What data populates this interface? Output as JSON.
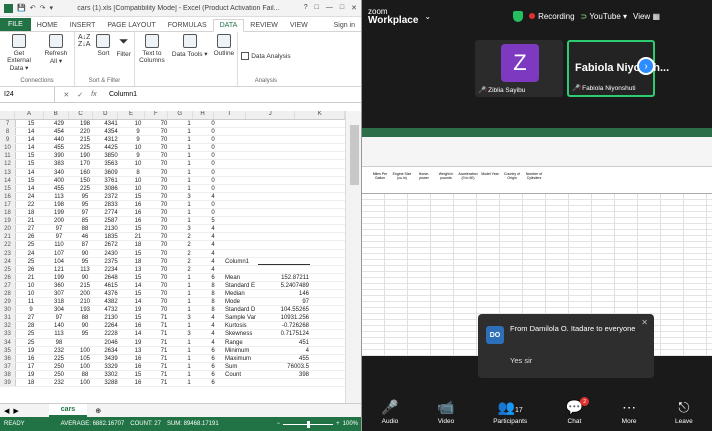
{
  "excel": {
    "quick_access": [
      "↶",
      "↷",
      "▾"
    ],
    "title": "cars (1).xls [Compatibility Mode] - Excel (Product Activation Fail...",
    "window_controls": [
      "?",
      "□",
      "—",
      "□",
      "✕"
    ],
    "tabs": [
      "FILE",
      "HOME",
      "INSERT",
      "PAGE LAYOUT",
      "FORMULAS",
      "DATA",
      "REVIEW",
      "VIEW"
    ],
    "active_tab": "DATA",
    "signin": "Sign in",
    "ribbon": {
      "get_external": "Get External Data ▾",
      "refresh": "Refresh All ▾",
      "connections": "Connections",
      "sort": "Sort",
      "filter": "Filter",
      "sort_filter": "Sort & Filter",
      "text_to_columns": "Text to Columns",
      "data_tools": "Data Tools ▾",
      "outline": "Outline",
      "data_analysis": "Data Analysis",
      "analysis": "Analysis"
    },
    "name_box": "I24",
    "formula": "Column1",
    "columns": [
      "A",
      "B",
      "C",
      "D",
      "E",
      "F",
      "G",
      "H",
      "I",
      "J",
      "K"
    ],
    "rows": [
      [
        "7",
        "15",
        "429",
        "198",
        "4341",
        "10",
        "70",
        "1",
        "0",
        "",
        ""
      ],
      [
        "8",
        "14",
        "454",
        "220",
        "4354",
        "9",
        "70",
        "1",
        "0",
        "",
        ""
      ],
      [
        "9",
        "14",
        "440",
        "215",
        "4312",
        "9",
        "70",
        "1",
        "0",
        "",
        ""
      ],
      [
        "10",
        "14",
        "455",
        "225",
        "4425",
        "10",
        "70",
        "1",
        "0",
        "",
        ""
      ],
      [
        "11",
        "15",
        "390",
        "190",
        "3850",
        "9",
        "70",
        "1",
        "0",
        "",
        ""
      ],
      [
        "12",
        "15",
        "383",
        "170",
        "3563",
        "10",
        "70",
        "1",
        "0",
        "",
        ""
      ],
      [
        "13",
        "14",
        "340",
        "160",
        "3609",
        "8",
        "70",
        "1",
        "0",
        "",
        ""
      ],
      [
        "14",
        "15",
        "400",
        "150",
        "3761",
        "10",
        "70",
        "1",
        "0",
        "",
        ""
      ],
      [
        "15",
        "14",
        "455",
        "225",
        "3086",
        "10",
        "70",
        "1",
        "0",
        "",
        ""
      ],
      [
        "16",
        "24",
        "113",
        "95",
        "2372",
        "15",
        "70",
        "3",
        "4",
        "",
        ""
      ],
      [
        "17",
        "22",
        "198",
        "95",
        "2833",
        "16",
        "70",
        "1",
        "0",
        "",
        ""
      ],
      [
        "18",
        "18",
        "199",
        "97",
        "2774",
        "16",
        "70",
        "1",
        "0",
        "",
        ""
      ],
      [
        "19",
        "21",
        "200",
        "85",
        "2587",
        "16",
        "70",
        "1",
        "5",
        "",
        ""
      ],
      [
        "20",
        "27",
        "97",
        "88",
        "2130",
        "15",
        "70",
        "3",
        "4",
        "",
        ""
      ],
      [
        "21",
        "26",
        "97",
        "46",
        "1835",
        "21",
        "70",
        "2",
        "4",
        "",
        ""
      ],
      [
        "22",
        "25",
        "110",
        "87",
        "2672",
        "18",
        "70",
        "2",
        "4",
        "",
        ""
      ],
      [
        "23",
        "24",
        "107",
        "90",
        "2430",
        "15",
        "70",
        "2",
        "4",
        "",
        ""
      ],
      [
        "24",
        "25",
        "104",
        "95",
        "2375",
        "18",
        "70",
        "2",
        "4",
        "Column1",
        ""
      ],
      [
        "25",
        "26",
        "121",
        "113",
        "2234",
        "13",
        "70",
        "2",
        "4",
        "",
        ""
      ],
      [
        "26",
        "21",
        "199",
        "90",
        "2648",
        "15",
        "70",
        "1",
        "6",
        "Mean",
        "152.87211"
      ],
      [
        "27",
        "10",
        "360",
        "215",
        "4615",
        "14",
        "70",
        "1",
        "8",
        "Standard E",
        "5.2407489"
      ],
      [
        "28",
        "10",
        "307",
        "200",
        "4376",
        "15",
        "70",
        "1",
        "8",
        "Median",
        "146"
      ],
      [
        "29",
        "11",
        "318",
        "210",
        "4382",
        "14",
        "70",
        "1",
        "8",
        "Mode",
        "97"
      ],
      [
        "30",
        "9",
        "304",
        "193",
        "4732",
        "19",
        "70",
        "1",
        "8",
        "Standard D",
        "104.55265"
      ],
      [
        "31",
        "27",
        "97",
        "88",
        "2130",
        "15",
        "71",
        "3",
        "4",
        "Sample Var",
        "10931.256"
      ],
      [
        "32",
        "28",
        "140",
        "90",
        "2264",
        "16",
        "71",
        "1",
        "4",
        "Kurtosis",
        "-0.726268"
      ],
      [
        "33",
        "25",
        "113",
        "95",
        "2228",
        "14",
        "71",
        "3",
        "4",
        "Skewness",
        "0.7175124"
      ],
      [
        "34",
        "25",
        "98",
        "",
        "2046",
        "19",
        "71",
        "1",
        "4",
        "Range",
        "451"
      ],
      [
        "35",
        "19",
        "232",
        "100",
        "2634",
        "13",
        "71",
        "1",
        "6",
        "Minimum",
        "4"
      ],
      [
        "36",
        "16",
        "225",
        "105",
        "3439",
        "16",
        "71",
        "1",
        "6",
        "Maximum",
        "455"
      ],
      [
        "37",
        "17",
        "250",
        "100",
        "3329",
        "16",
        "71",
        "1",
        "6",
        "Sum",
        "76003.5"
      ],
      [
        "38",
        "19",
        "250",
        "88",
        "3302",
        "15",
        "71",
        "1",
        "6",
        "Count",
        "398"
      ],
      [
        "39",
        "18",
        "232",
        "100",
        "3288",
        "16",
        "71",
        "1",
        "6",
        "",
        ""
      ]
    ],
    "sheet_tab": "cars",
    "status": {
      "ready": "READY",
      "average": "AVERAGE: 6882.16707",
      "count": "COUNT: 27",
      "sum": "SUM: 89468.17191",
      "zoom": "100%"
    }
  },
  "zoom": {
    "logo_top": "zoom",
    "logo_bottom": "Workplace",
    "recording": "Recording",
    "youtube": "YouTube ▾",
    "view": "View",
    "participants_tiles": [
      {
        "initial": "Z",
        "name": "Ziblia Sayibu",
        "muted": true
      },
      {
        "initial": "",
        "display": "Fabiola Niyonsh...",
        "name": "Fabiola Niyonshuti",
        "muted": true
      }
    ],
    "shared": {
      "headers": [
        "Miles Per Gallon",
        "Engine Size (cu.in)",
        "Horse-power",
        "Weight in pounds",
        "Acceleration (0 to 60)",
        "Model Year",
        "Country of Origin",
        "Number of Cylinders"
      ]
    },
    "chat": {
      "badge": "DO",
      "from": "From Damilola O. Itadare to everyone",
      "message": "Yes sir",
      "close": "✕"
    },
    "toolbar": {
      "audio": "Audio",
      "video": "Video",
      "participants": "Participants",
      "participant_count": "17",
      "chat": "Chat",
      "chat_count": "2",
      "more": "More",
      "leave": "Leave"
    },
    "colors": {
      "accent": "#2d8cff",
      "green": "#2ecc71",
      "red": "#e03030"
    }
  }
}
